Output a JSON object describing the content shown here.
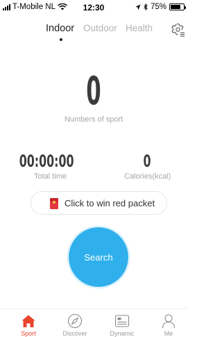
{
  "status_bar": {
    "carrier": "T-Mobile NL",
    "time": "12:30",
    "battery_percent": "75%",
    "battery_level": 0.75
  },
  "tabs": [
    {
      "label": "Indoor",
      "active": true
    },
    {
      "label": "Outdoor",
      "active": false
    },
    {
      "label": "Health",
      "active": false
    }
  ],
  "main": {
    "count": "0",
    "count_label": "Numbers of sport",
    "total_time": "00:00:00",
    "total_time_label": "Total time",
    "calories": "0",
    "calories_label": "Calories(kcal)",
    "red_packet_label": "Click to win red packet",
    "search_label": "Search"
  },
  "bottom_nav": [
    {
      "label": "Sport",
      "icon": "home-icon",
      "active": true
    },
    {
      "label": "Discover",
      "icon": "compass-icon",
      "active": false
    },
    {
      "label": "Dynamic",
      "icon": "feed-icon",
      "active": false
    },
    {
      "label": "Me",
      "icon": "person-icon",
      "active": false
    }
  ],
  "colors": {
    "accent_red": "#e8452c",
    "search_blue": "#2fb0ec",
    "text_dark": "#3c3c3c",
    "text_muted": "#a6a6a6"
  }
}
